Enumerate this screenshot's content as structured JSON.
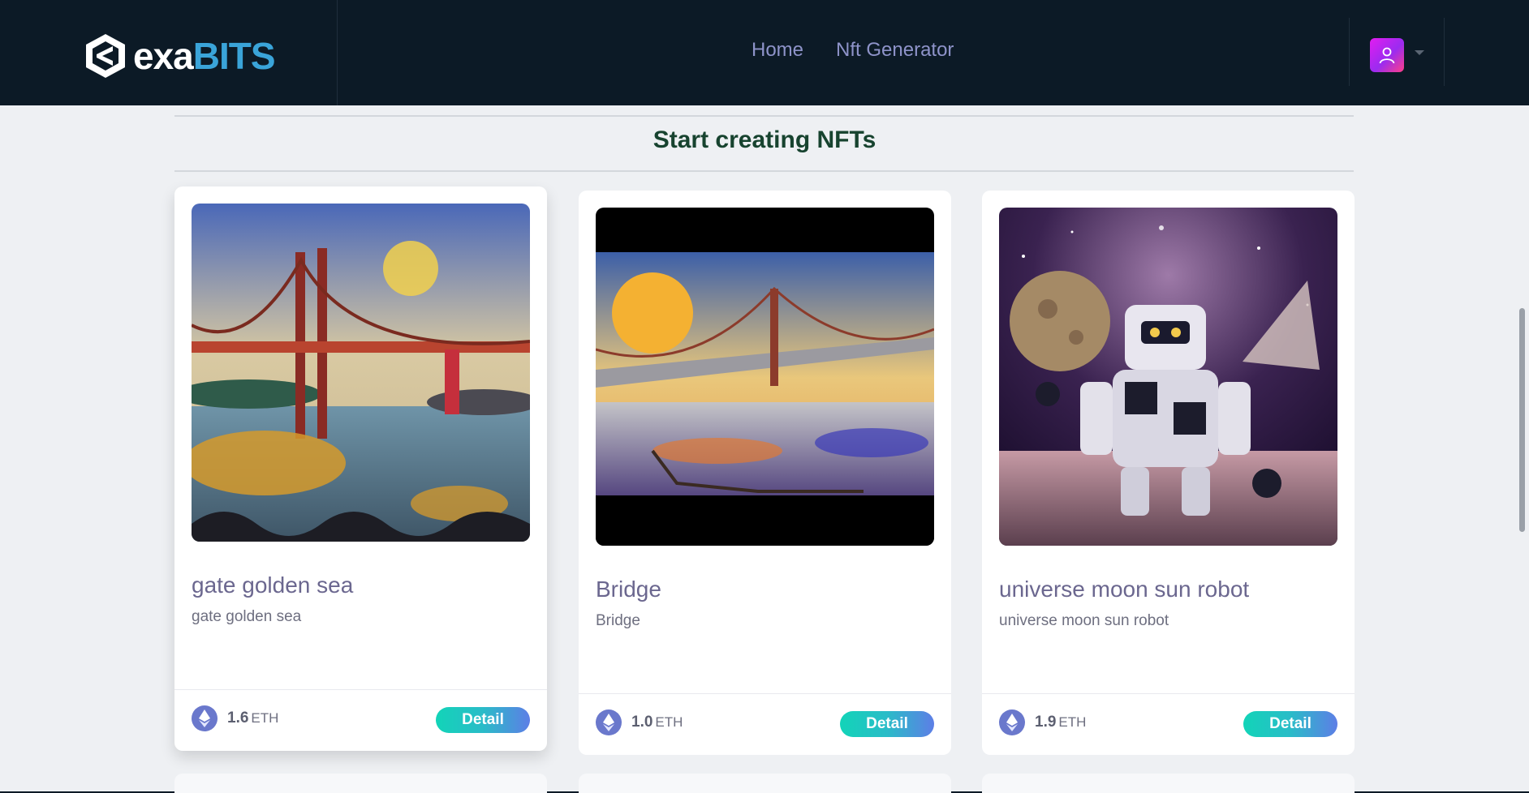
{
  "brand": {
    "part1": "exa",
    "part2": "BITS"
  },
  "nav": {
    "items": [
      {
        "label": "Home"
      },
      {
        "label": "Nft Generator"
      }
    ]
  },
  "main": {
    "title": "Start creating NFTs",
    "cards": [
      {
        "title": "gate golden sea",
        "description": "gate golden sea",
        "price": "1.6",
        "unit": "ETH",
        "button": "Detail"
      },
      {
        "title": "Bridge",
        "description": "Bridge",
        "price": "1.0",
        "unit": "ETH",
        "button": "Detail"
      },
      {
        "title": "universe moon sun robot",
        "description": "universe moon sun robot",
        "price": "1.9",
        "unit": "ETH",
        "button": "Detail"
      }
    ]
  },
  "colors": {
    "header_bg": "#0c1a26",
    "brand_accent": "#3aa4d9",
    "nav_text": "#8e93c9",
    "title_green": "#17432f",
    "button_gradient_start": "#12d4b8",
    "button_gradient_end": "#5d7ee6"
  },
  "icons": {
    "logo": "exabits-logo-icon",
    "avatar": "user-icon",
    "currency": "ethereum-icon",
    "menu": "caret-down-icon"
  }
}
